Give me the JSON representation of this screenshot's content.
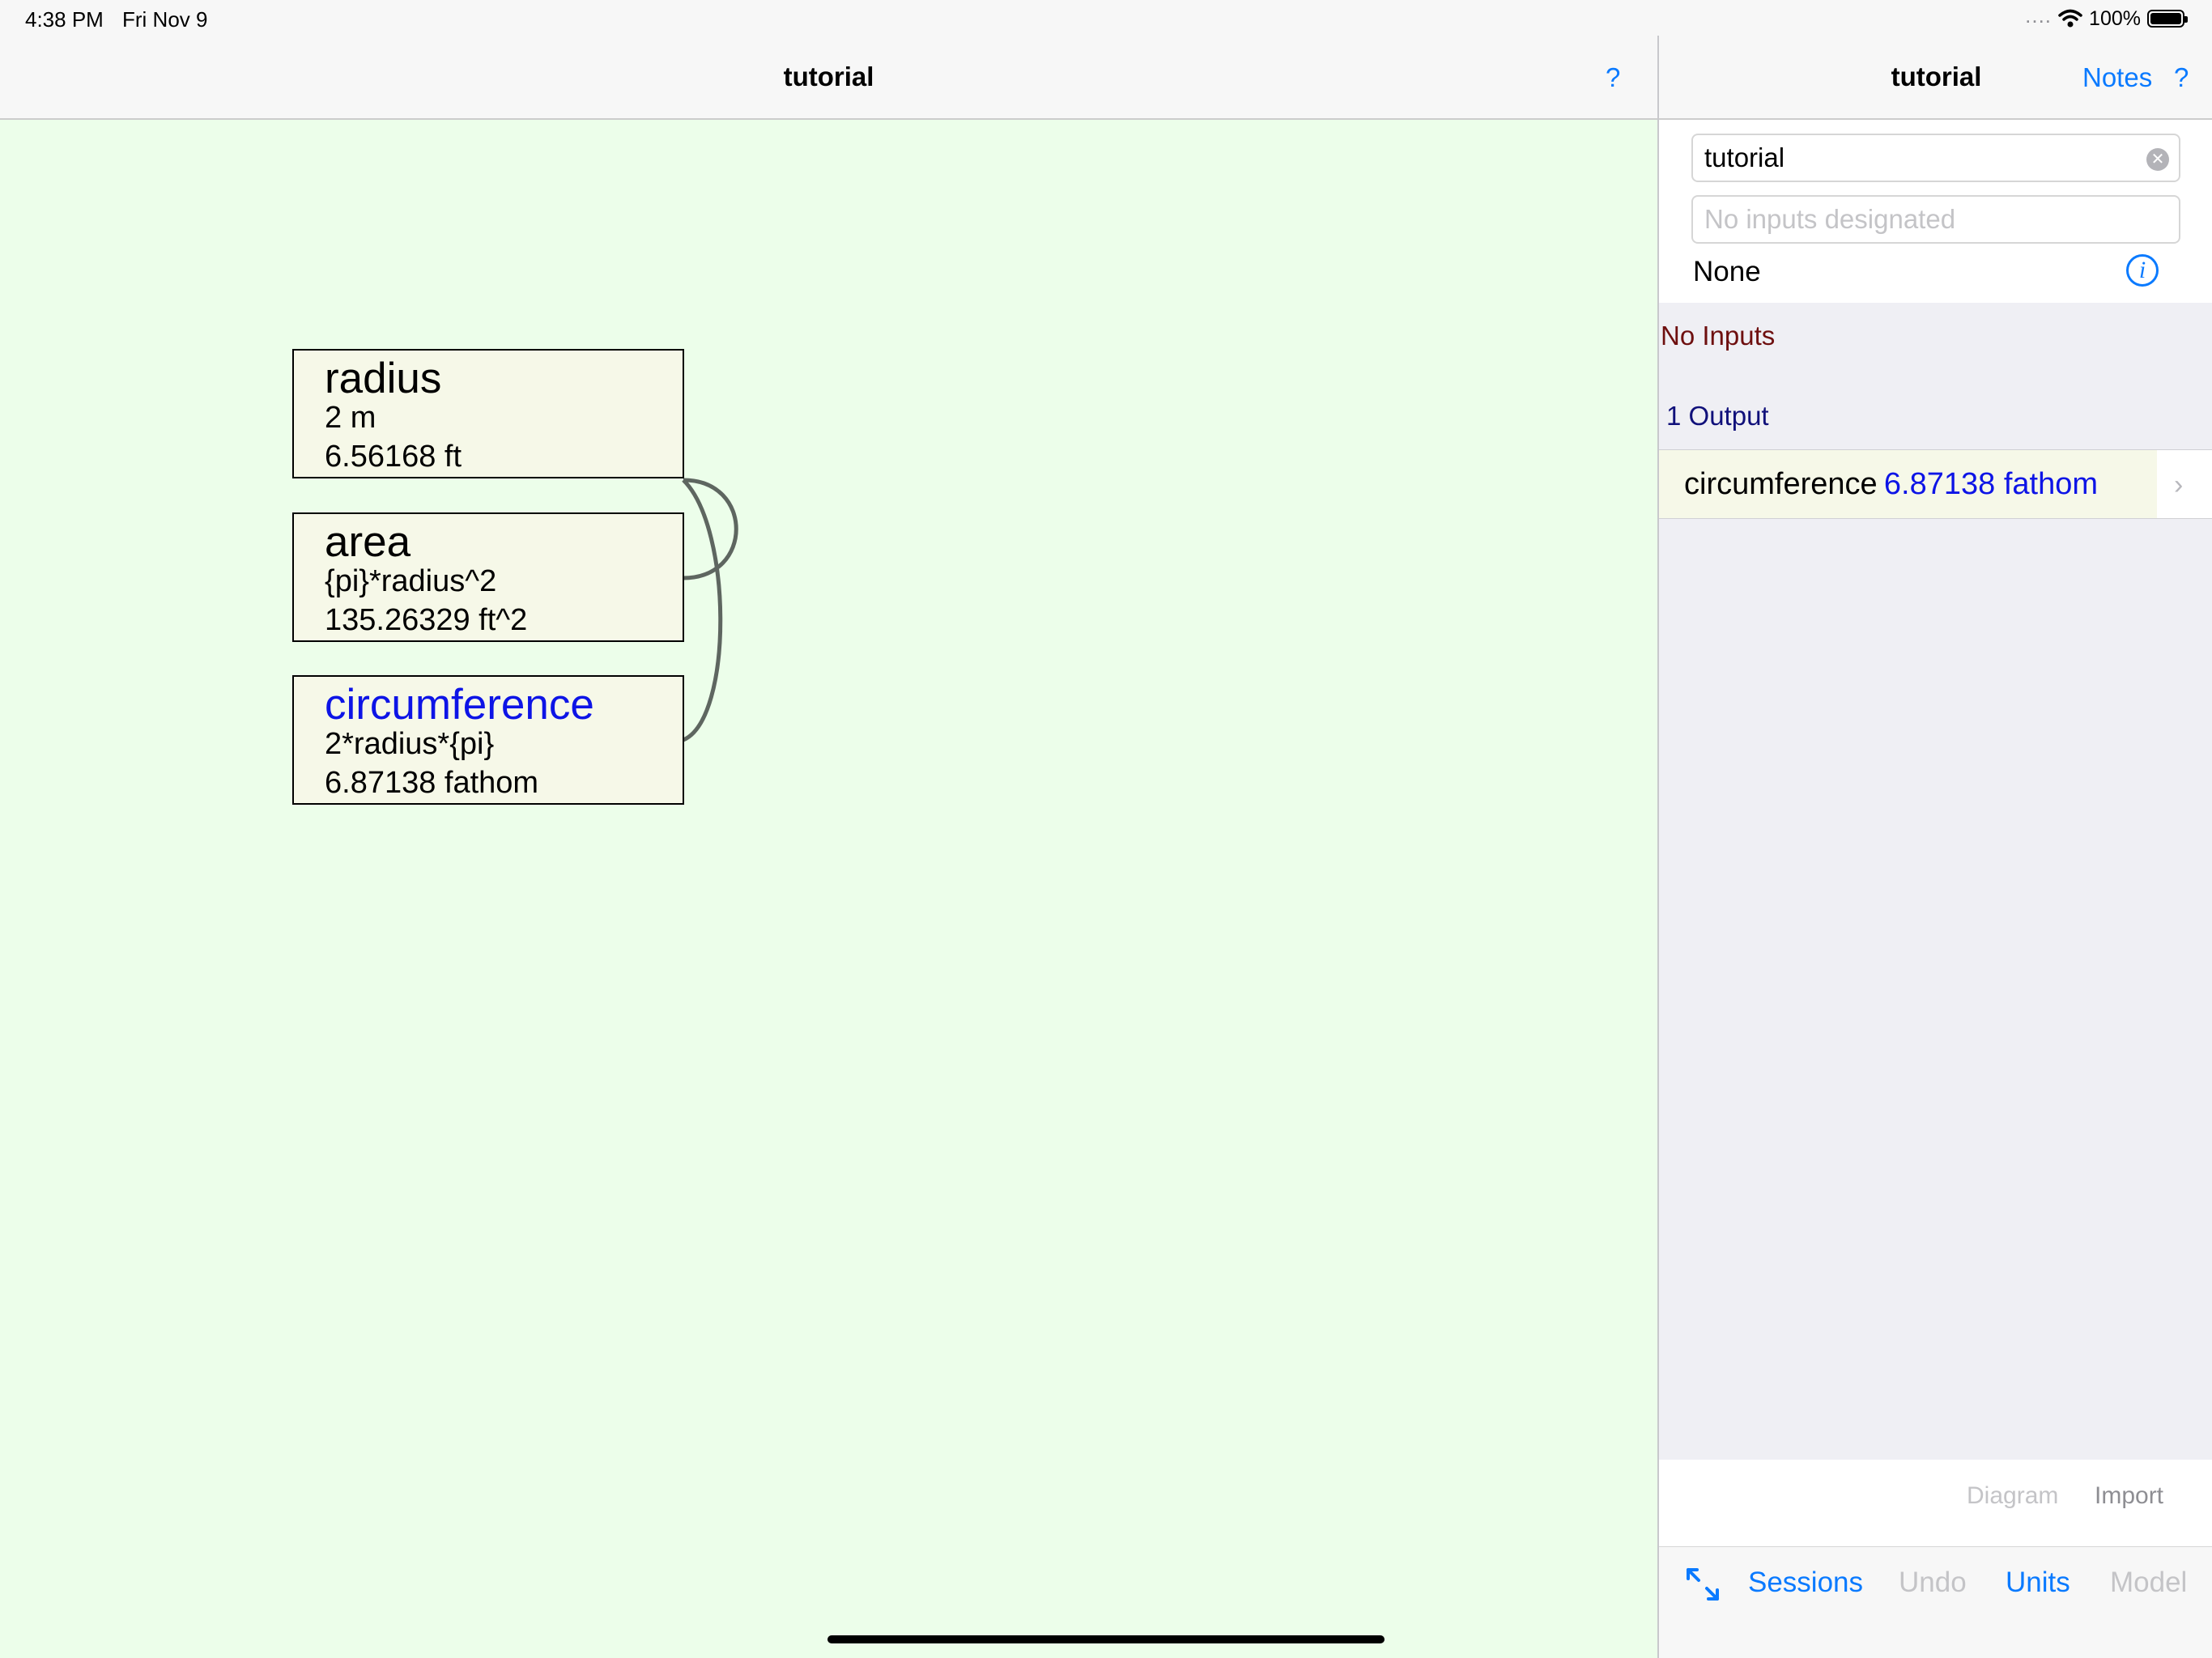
{
  "status_bar": {
    "time": "4:38 PM",
    "date": "Fri Nov 9",
    "signal": "....",
    "battery_percent": "100%",
    "battery_level": 1.0
  },
  "left_panel": {
    "title": "tutorial",
    "help_label": "?",
    "background_color": "#ecfeea",
    "nodes": [
      {
        "name": "radius",
        "line2": "2 m",
        "line3": "6.56168 ft",
        "is_output": false
      },
      {
        "name": "area",
        "line2": "{pi}*radius^2",
        "line3": "135.26329 ft^2",
        "is_output": false
      },
      {
        "name": "circumference",
        "line2": "2*radius*{pi}",
        "line3": "6.87138 fathom",
        "is_output": true
      }
    ],
    "edges": [
      {
        "from": "radius",
        "to": "area"
      },
      {
        "from": "radius",
        "to": "circumference"
      }
    ]
  },
  "right_panel": {
    "title": "tutorial",
    "notes_label": "Notes",
    "help_label": "?",
    "name_field_value": "tutorial",
    "inputs_placeholder": "No inputs designated",
    "selection_label": "None",
    "no_inputs_label": "No Inputs",
    "outputs_header": "1 Output",
    "outputs": [
      {
        "name": "circumference",
        "value": "6.87138 fathom"
      }
    ],
    "toolbar": {
      "diagram_label": "Diagram",
      "import_label": "Import"
    },
    "tabs": {
      "sessions": "Sessions",
      "undo": "Undo",
      "units": "Units",
      "model": "Model"
    }
  },
  "colors": {
    "accent": "#0a7aff",
    "output_node_text": "#0d14e6",
    "node_fill": "#f6f8e8",
    "no_inputs_text": "#6e0f0f",
    "outputs_header_text": "#10107a",
    "disabled": "#c4c4c7"
  },
  "icons": [
    "wifi-icon",
    "battery-icon",
    "clear-icon",
    "info-icon",
    "chevron-right-icon",
    "expand-icon"
  ]
}
